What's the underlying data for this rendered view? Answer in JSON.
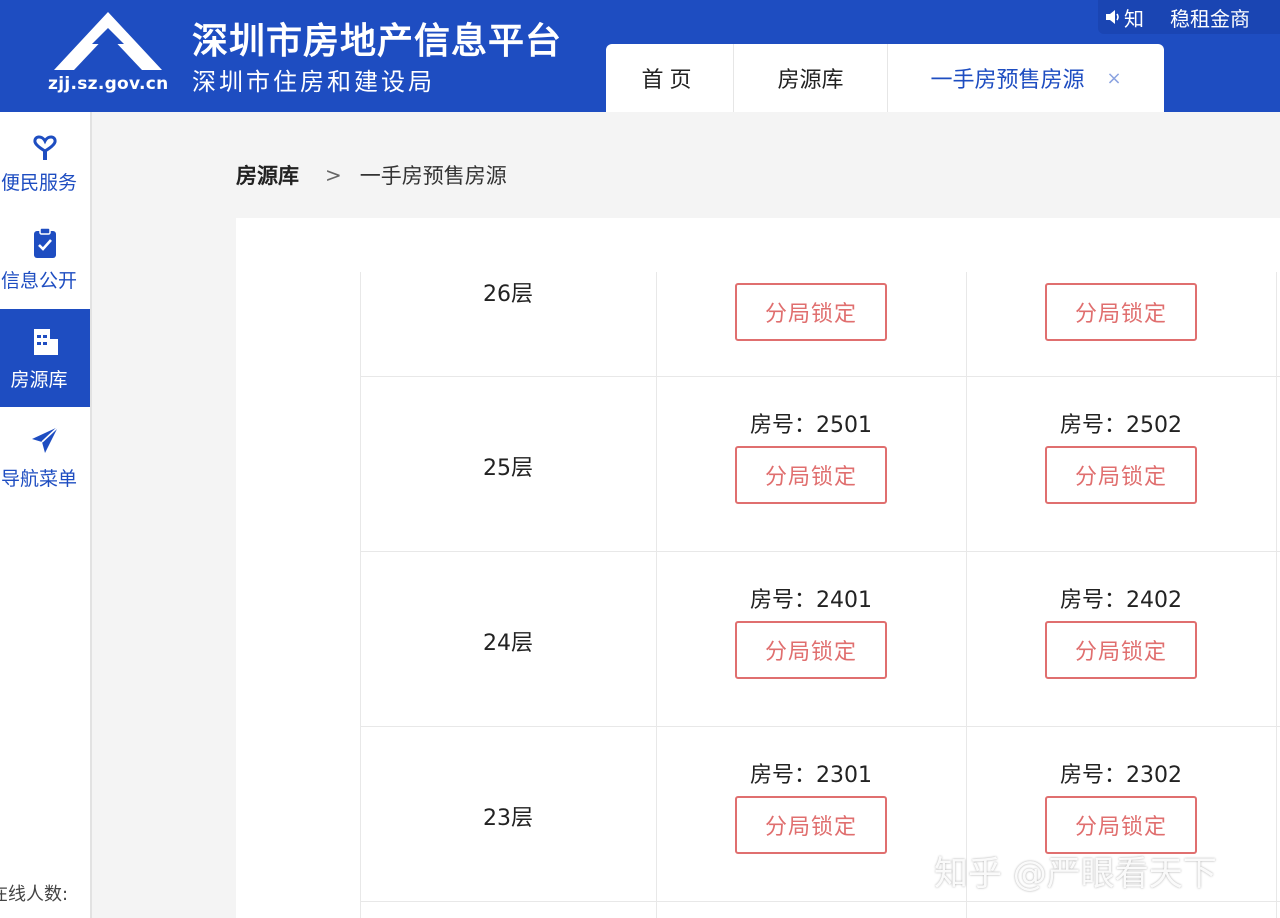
{
  "header": {
    "logo_url": "zjj.sz.gov.cn",
    "title": "深圳市房地产信息平台",
    "subtitle": "深圳市住房和建设局",
    "notice_prefix": "知",
    "notice_text": "稳租金商",
    "brand_color": "#1e4dc1"
  },
  "tabs": [
    {
      "label": "首页"
    },
    {
      "label": "房源库"
    },
    {
      "label": "一手房预售房源",
      "close": "×",
      "active": true
    }
  ],
  "sidebar": {
    "items": [
      {
        "label": "便民服务",
        "icon": "service-heart-icon"
      },
      {
        "label": "信息公开",
        "icon": "clipboard-check-icon"
      },
      {
        "label": "房源库",
        "icon": "building-icon",
        "active": true
      },
      {
        "label": "导航菜单",
        "icon": "paper-plane-icon"
      }
    ],
    "online_label": "在线人数:"
  },
  "breadcrumb": {
    "items": [
      "房源库",
      "一手房预售房源"
    ],
    "separator": ">"
  },
  "floors": [
    {
      "label": "26层",
      "rooms": [
        {
          "no": "",
          "action": "分局锁定"
        },
        {
          "no": "",
          "action": "分局锁定"
        }
      ]
    },
    {
      "label": "25层",
      "rooms": [
        {
          "no": "房号：2501",
          "action": "分局锁定"
        },
        {
          "no": "房号：2502",
          "action": "分局锁定"
        }
      ]
    },
    {
      "label": "24层",
      "rooms": [
        {
          "no": "房号：2401",
          "action": "分局锁定"
        },
        {
          "no": "房号：2402",
          "action": "分局锁定"
        }
      ]
    },
    {
      "label": "23层",
      "rooms": [
        {
          "no": "房号：2301",
          "action": "分局锁定"
        },
        {
          "no": "房号：2302",
          "action": "分局锁定"
        }
      ]
    }
  ],
  "watermark": "知乎 @严眼看天下",
  "colors": {
    "lock_red": "#e06f6f"
  }
}
